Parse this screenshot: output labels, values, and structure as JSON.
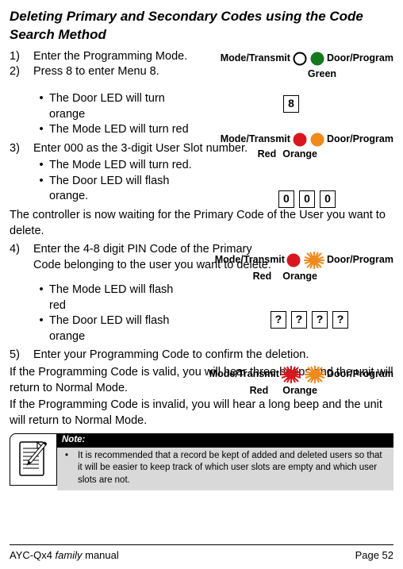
{
  "title": "Deleting Primary and Secondary Codes using the Code Search Method",
  "steps": {
    "s1": {
      "num": "1)",
      "text": "Enter the Programming Mode."
    },
    "s2": {
      "num": "2)",
      "text": "Press 8 to enter Menu 8."
    },
    "s2a": "The Door LED will turn orange",
    "s2b": "The Mode LED will turn red",
    "s3": {
      "num": "3)",
      "text": "Enter 000 as the 3-digit User Slot number."
    },
    "s3a": "The Mode LED will turn red.",
    "s3b": "The Door LED will flash orange.",
    "p_wait": "The controller is now waiting for the Primary Code of the User you want to delete.",
    "s4": {
      "num": "4)",
      "text": "Enter the 4-8 digit PIN Code of the Primary Code belonging to the user you want to delete."
    },
    "s4a": "The Mode LED will flash red",
    "s4b": "The Door LED will flash orange",
    "s5": {
      "num": "5)",
      "text": "Enter your Programming Code to confirm the deletion."
    },
    "p_valid": "If the Programming Code is valid, you will hear three beeps and the unit will return to Normal Mode.",
    "p_invalid": "If the Programming Code is invalid, you will hear a long beep and the unit will return to Normal Mode."
  },
  "labels": {
    "mode": "Mode/Transmit",
    "door": "Door/Program",
    "green": "Green",
    "red": "Red",
    "orange": "Orange"
  },
  "keys": {
    "eight": "8",
    "zero": "0",
    "q": "?"
  },
  "note": {
    "hdr": "Note:",
    "body": "It is recommended that a record be kept of added and deleted users so that it will be easier to keep track of which user slots are empty and which user slots are not."
  },
  "footer": {
    "prod_a": "AYC-Qx4",
    "prod_b": " family ",
    "prod_c": "manual",
    "page": "Page 52"
  },
  "colors": {
    "green": "#157a1c",
    "red": "#d8171e",
    "orange": "#f08a1a"
  }
}
